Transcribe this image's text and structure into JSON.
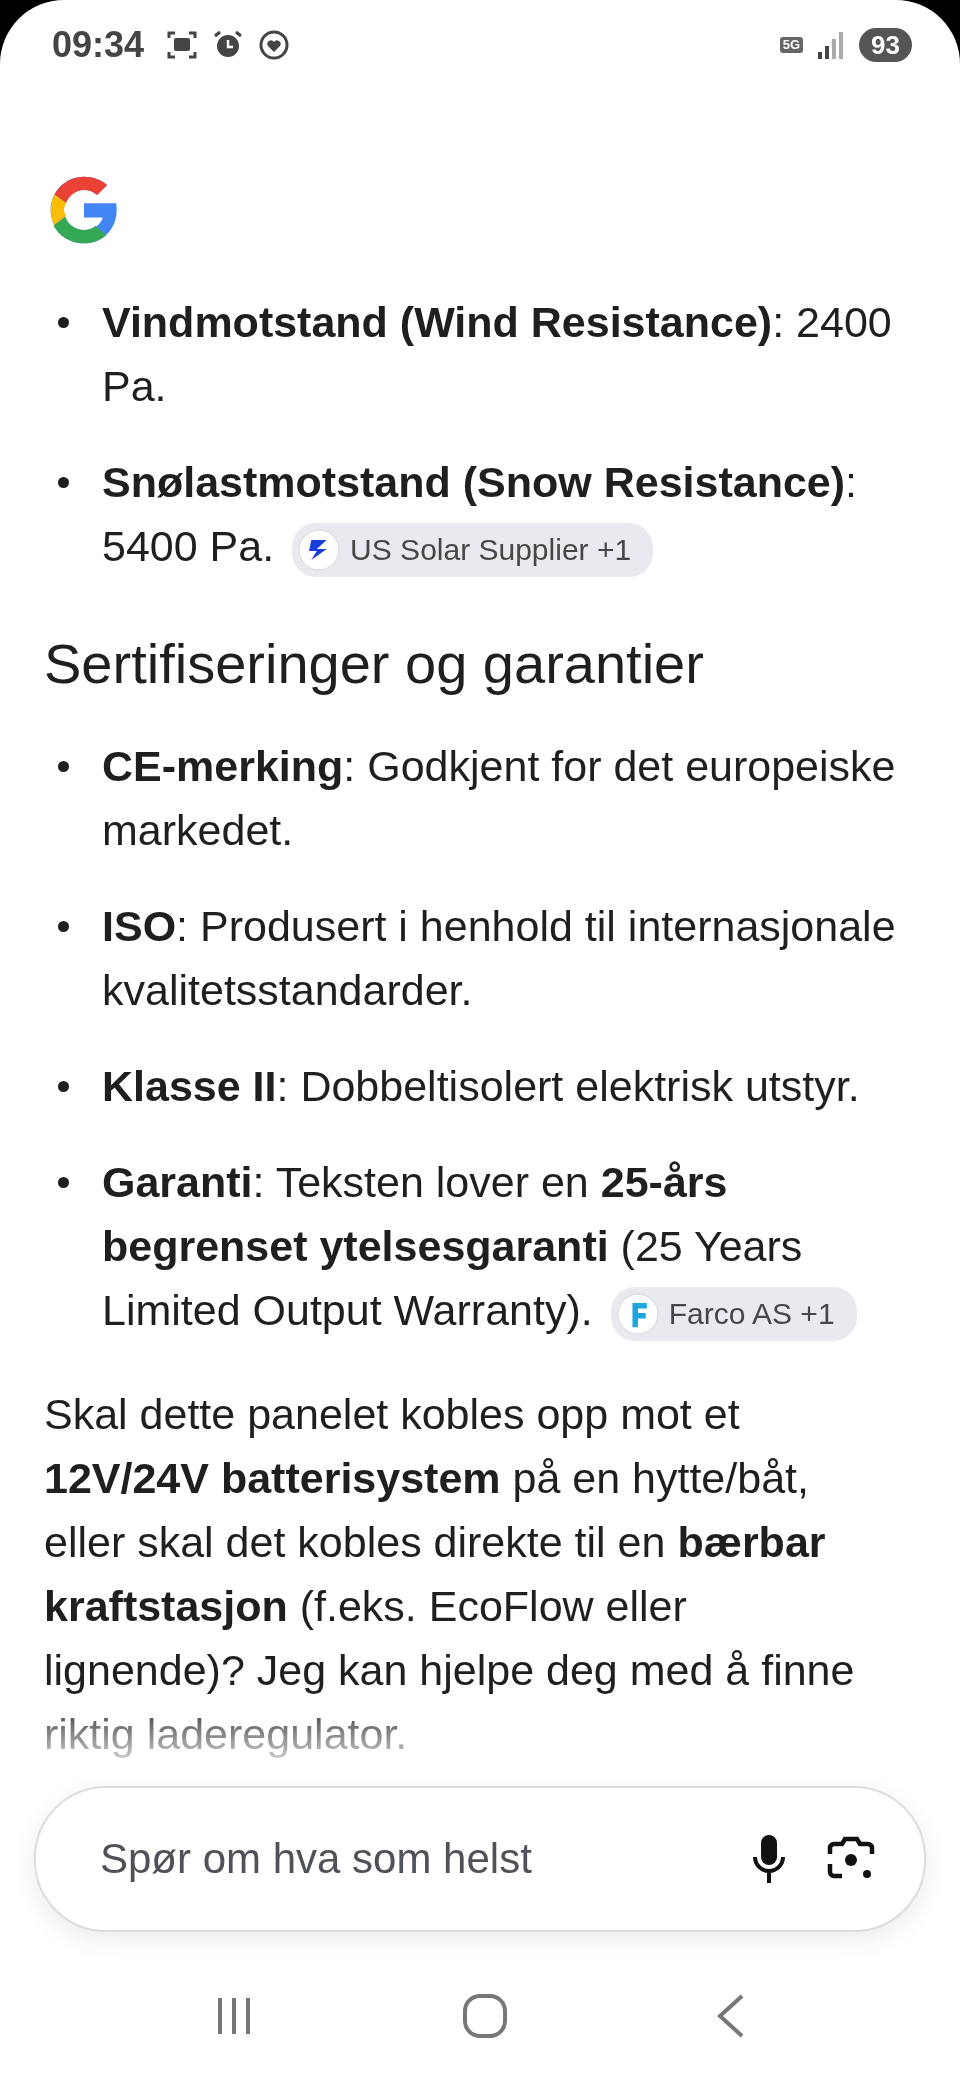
{
  "status_bar": {
    "time": "09:34",
    "network": "5G",
    "battery": "93"
  },
  "blocks": [
    {
      "kind": "list",
      "items": [
        {
          "text": "**Vindmotstand (Wind Resistance)**: 2400 Pa."
        },
        {
          "text": "**Snølastmotstand (Snow Resistance)**: 5400 Pa.",
          "source": {
            "label": "US Solar Supplier +1",
            "kind": "bolt"
          }
        }
      ]
    },
    {
      "kind": "heading",
      "text": "Sertifiseringer og garantier"
    },
    {
      "kind": "list",
      "items": [
        {
          "text": "**CE-merking**: Godkjent for det europeiske markedet."
        },
        {
          "text": "**ISO**: Produsert i henhold til internasjonale kvalitetsstandarder."
        },
        {
          "text": "**Klasse II**: Dobbeltisolert elektrisk utstyr."
        },
        {
          "text": "**Garanti**: Teksten lover en **25-års begrenset ytelsesgaranti** (25 Years Limited Output Warranty).",
          "source": {
            "label": "Farco AS +1",
            "kind": "letter-f"
          }
        }
      ]
    },
    {
      "kind": "paragraph",
      "text": "Skal dette panelet kobles opp mot et **12V/24V batterisystem** på en hytte/båt, eller skal det kobles direkte til en **bærbar kraftstasjon** (f.eks. EcoFlow eller lignende)? Jeg kan hjelpe deg med å finne riktig laderegulator."
    }
  ],
  "search": {
    "placeholder": "Spør om hva som helst"
  }
}
